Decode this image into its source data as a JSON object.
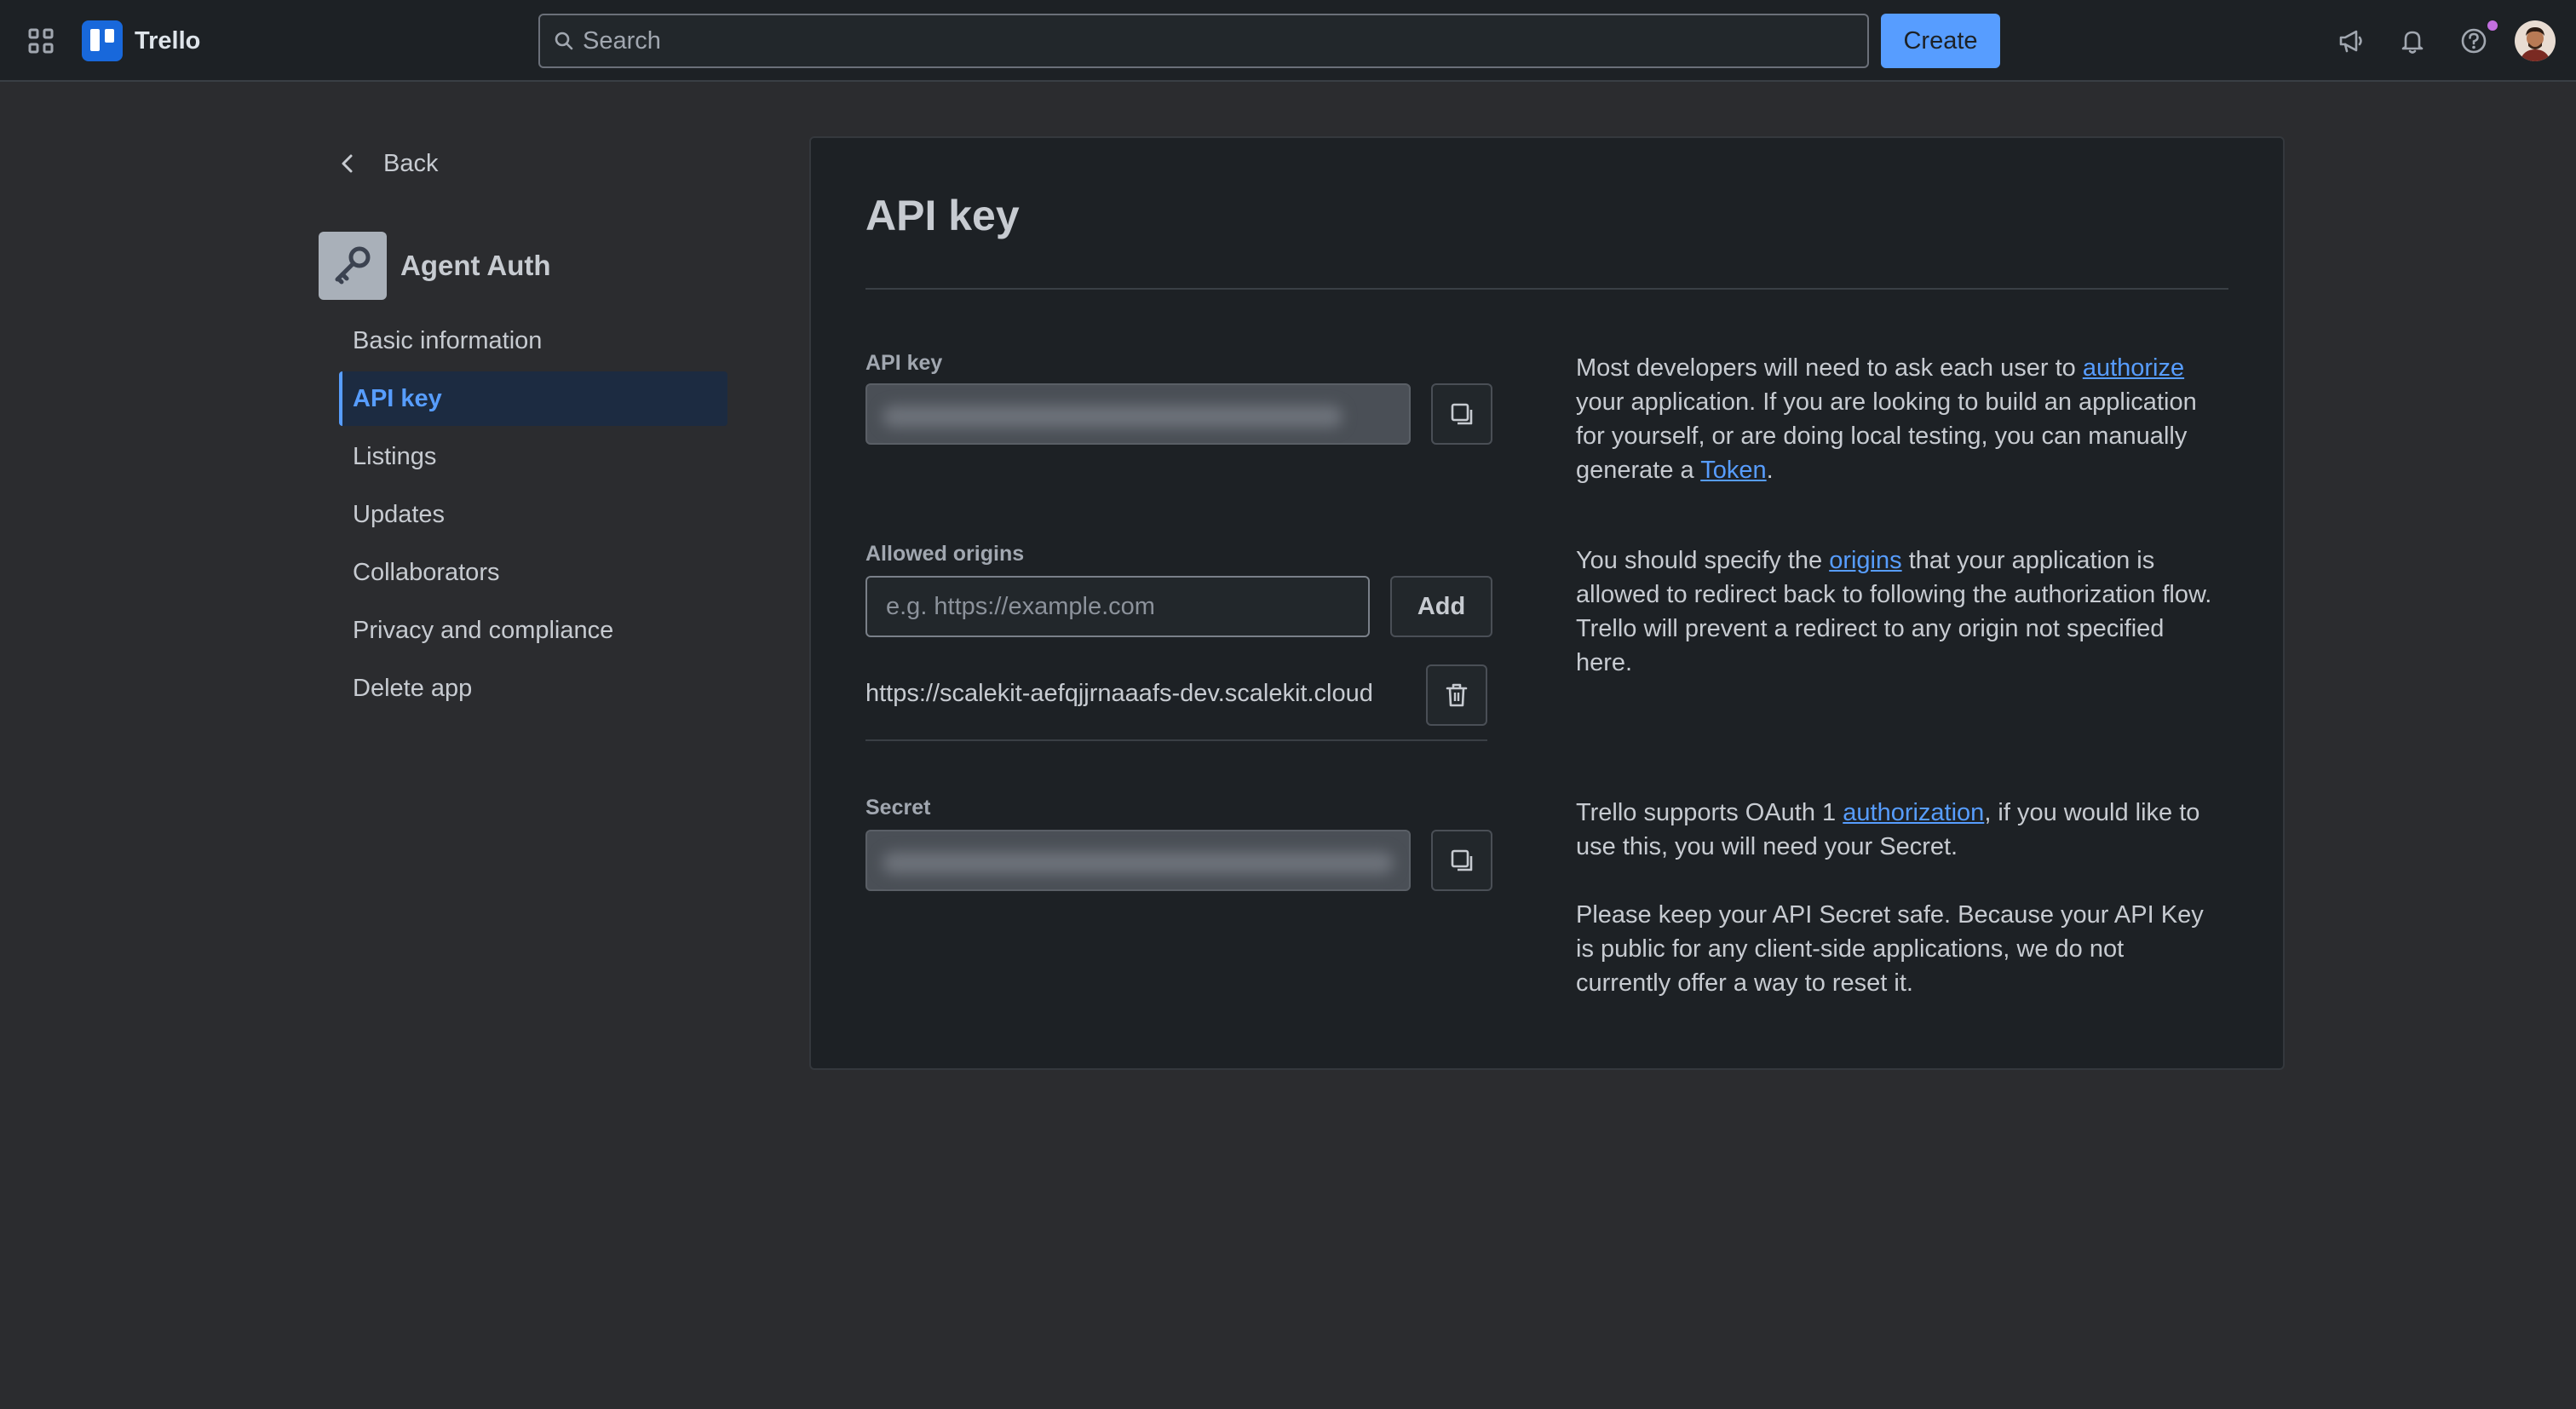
{
  "colors": {
    "accent": "#579dff",
    "background": "#2b2c2f",
    "card": "#1d2125",
    "topbar": "#1d2125",
    "notification_dot": "#c36fe0"
  },
  "topbar": {
    "brand": "Trello",
    "search_placeholder": "Search",
    "create_label": "Create",
    "icons": [
      "apps-grid-icon",
      "megaphone-icon",
      "bell-icon",
      "help-icon",
      "avatar"
    ]
  },
  "sidebar": {
    "back_label": "Back",
    "app_name": "Agent Auth",
    "app_icon": "key-icon",
    "items": [
      {
        "label": "Basic information",
        "active": false
      },
      {
        "label": "API key",
        "active": true
      },
      {
        "label": "Listings",
        "active": false
      },
      {
        "label": "Updates",
        "active": false
      },
      {
        "label": "Collaborators",
        "active": false
      },
      {
        "label": "Privacy and compliance",
        "active": false
      },
      {
        "label": "Delete app",
        "active": false
      }
    ]
  },
  "main": {
    "title": "API key",
    "api_key": {
      "label": "API key",
      "help": {
        "before": "Most developers will need to ask each user to ",
        "link1": "authorize",
        "middle": " your application. If you are looking to build an application for yourself, or are doing local testing, you can manually generate a ",
        "link2": "Token",
        "after": "."
      }
    },
    "origins": {
      "label": "Allowed origins",
      "placeholder": "e.g. https://example.com",
      "add_label": "Add",
      "values": [
        "https://scalekit-aefqjjrnaaafs-dev.scalekit.cloud"
      ],
      "help": {
        "before": "You should specify the ",
        "link": "origins",
        "after": " that your application is allowed to redirect back to following the authorization flow. Trello will prevent a redirect to any origin not specified here."
      }
    },
    "secret": {
      "label": "Secret",
      "help1": {
        "before": "Trello supports OAuth 1 ",
        "link": "authorization",
        "after": ", if you would like to use this, you will need your Secret."
      },
      "help2": "Please keep your API Secret safe. Because your API Key is public for any client-side applications, we do not currently offer a way to reset it."
    }
  }
}
